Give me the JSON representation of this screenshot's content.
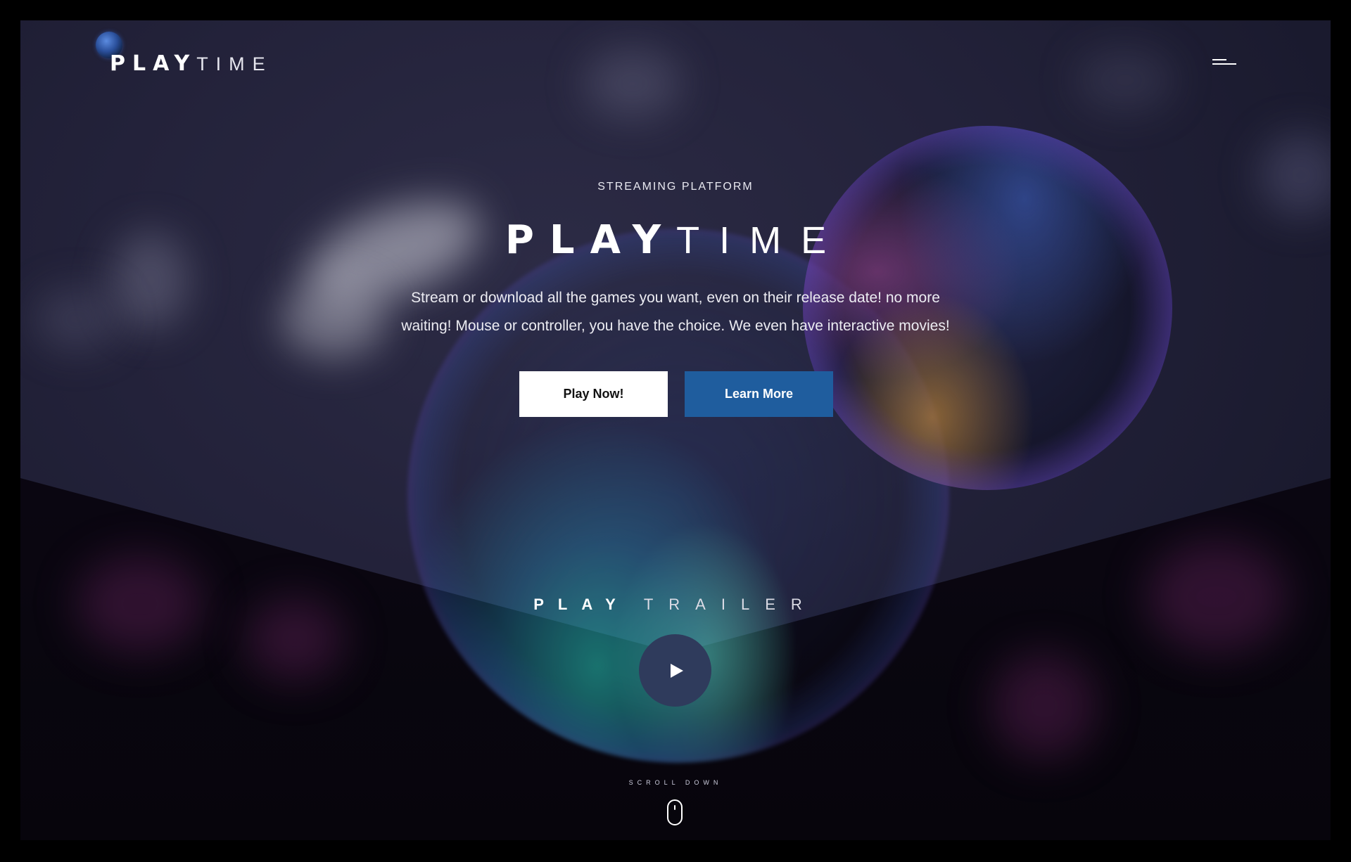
{
  "header": {
    "logo_play": "PLAY",
    "logo_time": "TIME",
    "menu_icon": "hamburger-menu-icon"
  },
  "hero": {
    "eyebrow": "STREAMING PLATFORM",
    "title_play": "PLAY",
    "title_time": "TIME",
    "description": "Stream or download all the games you want, even on their release date! no more waiting! Mouse or controller, you have the choice. We even have interactive movies!",
    "buttons": {
      "play_now": "Play Now!",
      "learn_more": "Learn More"
    }
  },
  "trailer": {
    "title_play": "PLAY",
    "title_trailer": "TRAILER",
    "play_icon": "play-icon"
  },
  "scroll": {
    "label": "SCROLL DOWN",
    "icon": "mouse-icon"
  },
  "colors": {
    "accent_blue": "#1f5d9e",
    "play_circle": "#2f3b5c",
    "background_top": "#23223a",
    "background_bottom": "#07050c"
  }
}
